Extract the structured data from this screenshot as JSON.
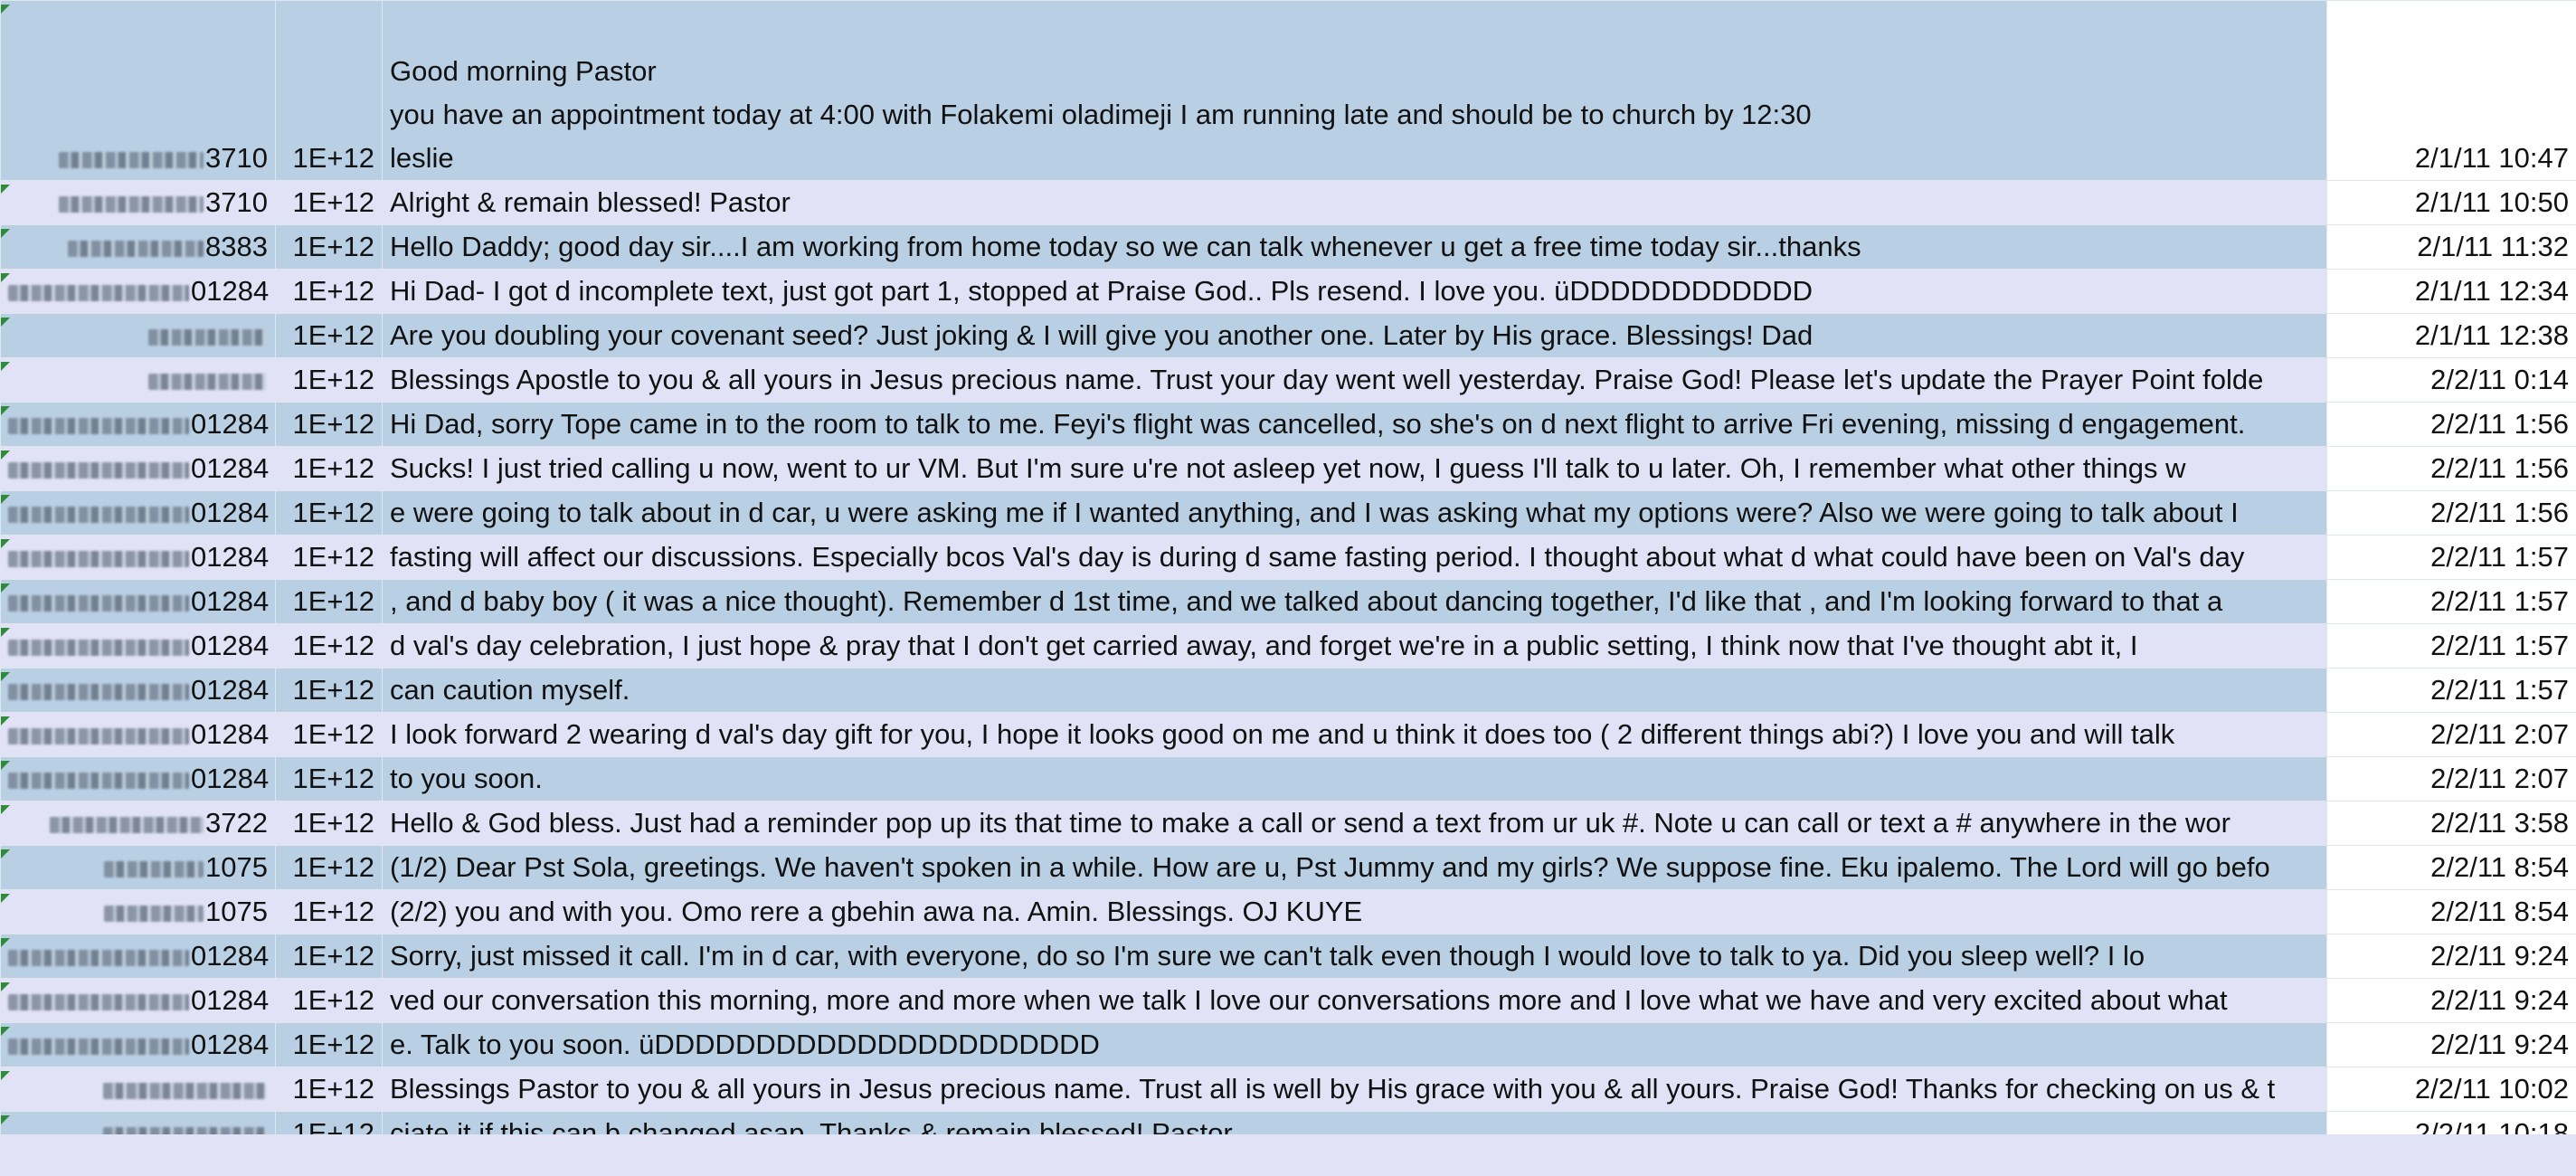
{
  "sheet": {
    "rows": [
      {
        "phone_suffix": "3710",
        "blur_w": 160,
        "count": "1E+12",
        "lines": [
          "Good morning Pastor",
          "you have an appointment today at 4:00 with Folakemi oladimeji  I am running late and should be to church by 12:30",
          "leslie"
        ],
        "date": "2/1/11 10:47",
        "tone": "blue"
      },
      {
        "phone_suffix": "3710",
        "blur_w": 160,
        "count": "1E+12",
        "message": "Alright & remain blessed! Pastor",
        "date": "2/1/11 10:50",
        "tone": "lav"
      },
      {
        "phone_suffix": "8383",
        "blur_w": 150,
        "count": "1E+12",
        "message": "Hello Daddy; good day sir....I am working from home today so we can talk whenever u get a free time today sir...thanks",
        "date": "2/1/11 11:32",
        "tone": "blue"
      },
      {
        "phone_suffix": "01284",
        "blur_w": 200,
        "count": "1E+12",
        "message": "Hi Dad- I got d incomplete text, just got part 1, stopped at Praise God.. Pls resend. I love you. üDDDDDDDDDDDD",
        "date": "2/1/11 12:34",
        "tone": "lav"
      },
      {
        "phone_suffix": "",
        "blur_w": 130,
        "count": "1E+12",
        "message": "Are you doubling your covenant seed? Just joking & I will give you another one. Later by His grace. Blessings! Dad",
        "date": "2/1/11 12:38",
        "tone": "blue"
      },
      {
        "phone_suffix": "",
        "blur_w": 130,
        "count": "1E+12",
        "message": "Blessings Apostle to you & all yours in Jesus precious name. Trust your day went well yesterday. Praise God! Please let's update the Prayer Point folde",
        "date": "2/2/11 0:14",
        "tone": "lav"
      },
      {
        "phone_suffix": "01284",
        "blur_w": 200,
        "count": "1E+12",
        "message": "Hi Dad, sorry Tope came in to the room to talk to me. Feyi's flight was cancelled, so she's on d next flight to arrive Fri evening, missing d engagement.",
        "date": "2/2/11 1:56",
        "tone": "blue"
      },
      {
        "phone_suffix": "01284",
        "blur_w": 200,
        "count": "1E+12",
        "message": "Sucks! I just tried calling u now, went to ur VM. But I'm sure u're not asleep yet now, I guess I'll talk to u later. Oh, I remember what other things w",
        "date": "2/2/11 1:56",
        "tone": "lav"
      },
      {
        "phone_suffix": "01284",
        "blur_w": 200,
        "count": "1E+12",
        "message": "e were going to talk about in d car, u were asking me if I wanted anything, and I was asking what my options were? Also we were going to talk about I",
        "date": "2/2/11 1:56",
        "tone": "blue"
      },
      {
        "phone_suffix": "01284",
        "blur_w": 200,
        "count": "1E+12",
        "message": "fasting will affect our discussions. Especially bcos Val's day is during d same fasting period. I thought about what d what could have been on Val's day",
        "date": "2/2/11 1:57",
        "tone": "lav"
      },
      {
        "phone_suffix": "01284",
        "blur_w": 200,
        "count": "1E+12",
        "message": ", and d baby boy ( it was a nice thought). Remember d 1st time, and we talked about dancing together, I'd like that , and I'm looking forward to that a",
        "date": "2/2/11 1:57",
        "tone": "blue"
      },
      {
        "phone_suffix": "01284",
        "blur_w": 200,
        "count": "1E+12",
        "message": "d val's day celebration, I just hope & pray that I don't get carried away, and forget we're in a public setting, I think now that I've thought abt it, I",
        "date": "2/2/11 1:57",
        "tone": "lav"
      },
      {
        "phone_suffix": "01284",
        "blur_w": 200,
        "count": "1E+12",
        "message": "can caution myself.",
        "date": "2/2/11 1:57",
        "tone": "blue"
      },
      {
        "phone_suffix": "01284",
        "blur_w": 200,
        "count": "1E+12",
        "message": "I look forward 2 wearing d val's day gift for you, I hope it looks good on me and u think it does too ( 2 different things abi?) I love you and will talk",
        "date": "2/2/11 2:07",
        "tone": "lav"
      },
      {
        "phone_suffix": "01284",
        "blur_w": 200,
        "count": "1E+12",
        "message": "to you  soon.",
        "date": "2/2/11 2:07",
        "tone": "blue"
      },
      {
        "phone_suffix": "3722",
        "blur_w": 170,
        "count": "1E+12",
        "message": "Hello & God bless. Just had a reminder pop up its that time to make a call or send a text from ur uk #. Note u can call or text a # anywhere in the wor",
        "date": "2/2/11 3:58",
        "tone": "lav"
      },
      {
        "phone_suffix": "1075",
        "blur_w": 110,
        "count": "1E+12",
        "message": "(1/2) Dear Pst Sola, greetings. We haven't spoken in a while. How are u, Pst Jummy and my girls? We suppose fine. Eku ipalemo. The Lord will go befo",
        "date": "2/2/11 8:54",
        "tone": "blue"
      },
      {
        "phone_suffix": "1075",
        "blur_w": 110,
        "count": "1E+12",
        "message": "(2/2) you and with you. Omo rere a gbehin awa na. Amin. Blessings. OJ KUYE",
        "date": "2/2/11 8:54",
        "tone": "lav"
      },
      {
        "phone_suffix": "01284",
        "blur_w": 200,
        "count": "1E+12",
        "message": "Sorry, just missed it call. I'm in d car, with everyone, do so I'm sure we can't talk even though    I would love to talk to ya. Did you sleep well? I lo",
        "date": "2/2/11 9:24",
        "tone": "blue"
      },
      {
        "phone_suffix": "01284",
        "blur_w": 200,
        "count": "1E+12",
        "message": "ved our conversation this morning, more and more when we talk I love our conversations more and I love what we have and very excited about what",
        "date": "2/2/11 9:24",
        "tone": "lav"
      },
      {
        "phone_suffix": "01284",
        "blur_w": 200,
        "count": "1E+12",
        "message": "e. Talk to you soon. üDDDDDDDDDDDDDDDDDDDDDD",
        "date": "2/2/11 9:24",
        "tone": "blue"
      },
      {
        "phone_suffix": "",
        "blur_w": 180,
        "count": "1E+12",
        "message": "Blessings Pastor to you & all yours in Jesus precious name. Trust all is well by His grace with you & all yours. Praise God! Thanks for checking on us & t",
        "date": "2/2/11 10:02",
        "tone": "lav"
      },
      {
        "phone_suffix": "",
        "blur_w": 180,
        "count": "1E+12",
        "message": "ciate it if this can b changed asap. Thanks & remain blessed! Pastor",
        "date": "2/2/11 10:18",
        "tone": "blue"
      }
    ]
  }
}
